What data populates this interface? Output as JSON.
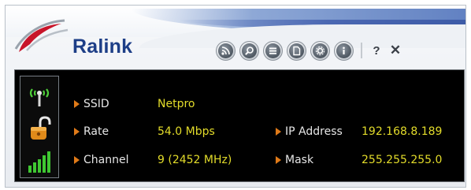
{
  "app": {
    "name": "Ralink"
  },
  "colors": {
    "value_text": "#e3dc2a",
    "label_text": "#e6e6e6",
    "bullet": "#e07a18",
    "brand": "#1d3e87",
    "logo_red": "#c8152a"
  },
  "toolbar": {
    "buttons": [
      {
        "name": "rss-icon"
      },
      {
        "name": "search-icon"
      },
      {
        "name": "list-icon"
      },
      {
        "name": "document-icon"
      },
      {
        "name": "settings-icon"
      },
      {
        "name": "info-icon"
      }
    ],
    "help_label": "?",
    "close_label": "✕"
  },
  "status": {
    "ssid_label": "SSID",
    "ssid_value": "Netpro",
    "rate_label": "Rate",
    "rate_value": "54.0 Mbps",
    "channel_label": "Channel",
    "channel_value": "9 (2452 MHz)",
    "ip_label": "IP Address",
    "ip_value": "192.168.8.189",
    "mask_label": "Mask",
    "mask_value": "255.255.255.0"
  },
  "indicators": {
    "signal_bars_total": 5,
    "signal_bars_lit": 5
  }
}
